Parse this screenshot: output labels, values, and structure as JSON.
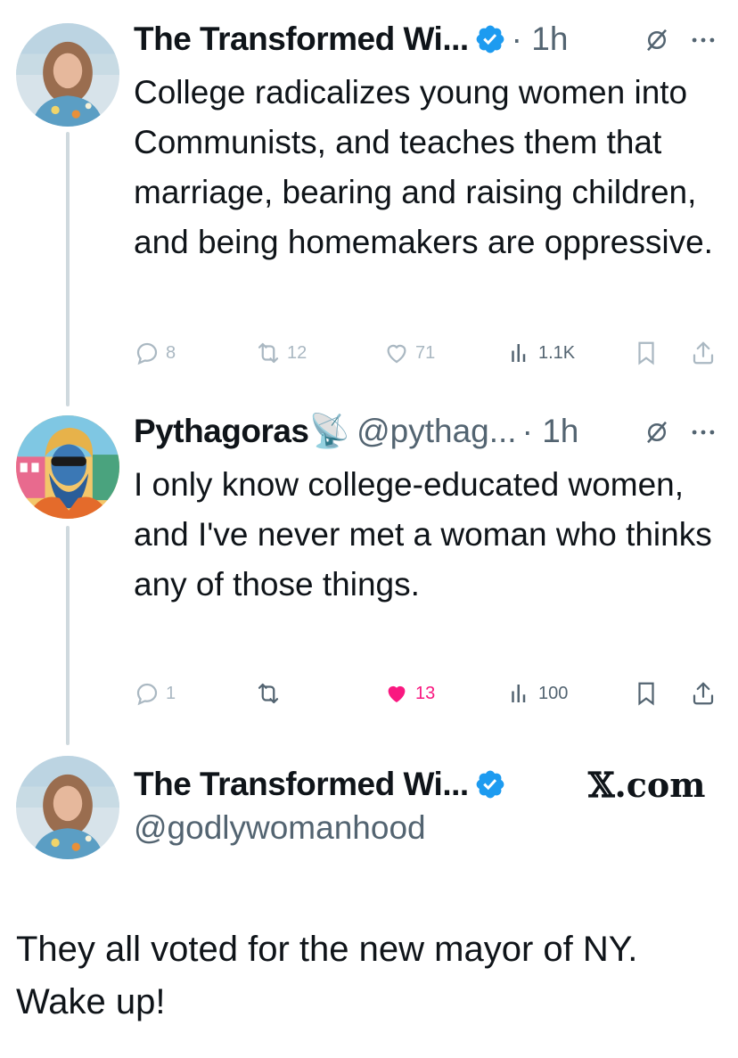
{
  "tweets": [
    {
      "name": "The Transformed Wi...",
      "handle": "",
      "time": "· 1h",
      "text": "College radicalizes young women into Communists, and teaches them that marriage, bearing and raising children, and being homemakers are oppressive.",
      "replies": "8",
      "reposts": "12",
      "likes": "71",
      "views": "1.1K"
    },
    {
      "name": "Pythagoras📡",
      "handle": "@pythag...",
      "time": "· 1h",
      "text": "I only know college-educated women, and I've never met a woman who thinks any of those things.",
      "replies": "1",
      "reposts": "",
      "likes": "13",
      "views": "100"
    }
  ],
  "post": {
    "name": "The Transformed Wi...",
    "handle": "@godlywomanhood",
    "text": "They all voted for the new mayor of NY. Wake up!"
  },
  "watermark": "𝕏.com",
  "icons": {
    "verified": "verified-badge-icon",
    "grok": "grok-icon",
    "more": "more-icon",
    "reply": "reply-icon",
    "repost": "repost-icon",
    "like": "heart-icon",
    "views": "views-icon",
    "bookmark": "bookmark-icon",
    "share": "share-icon"
  },
  "colors": {
    "verified": "#1d9bf0",
    "like_active": "#f91880",
    "muted": "#536471",
    "faded": "#aab8c2",
    "thread_line": "#cfd9de"
  }
}
